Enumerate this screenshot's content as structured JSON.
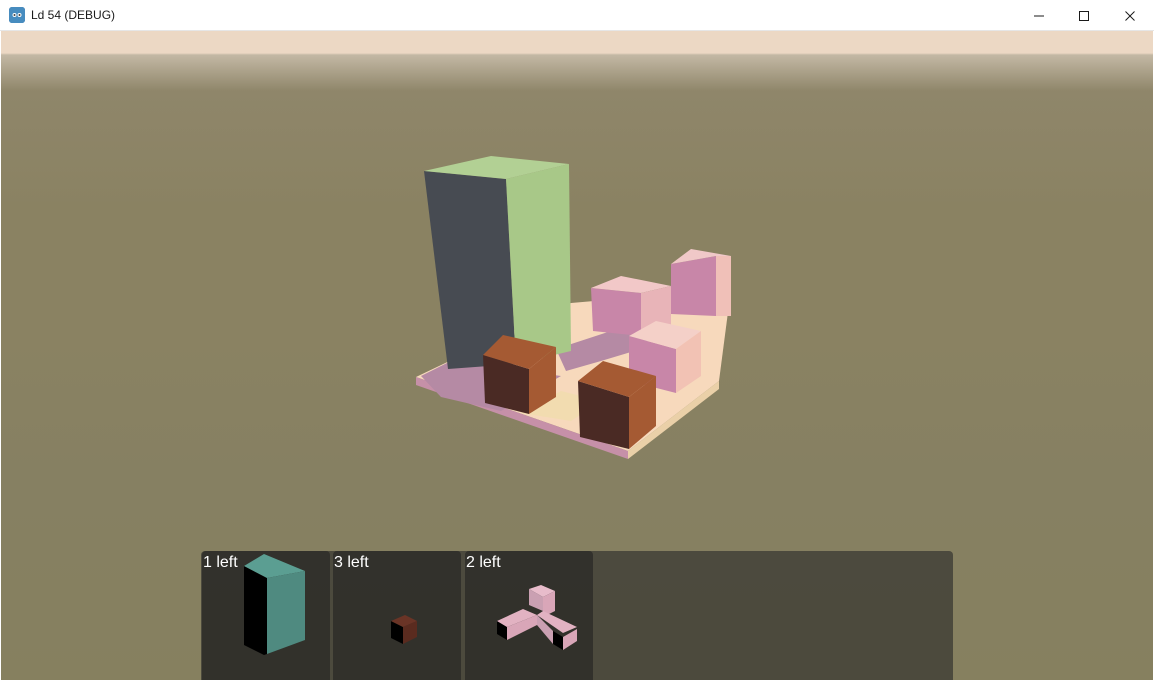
{
  "window": {
    "title": "Ld 54 (DEBUG)",
    "controls": {
      "minimize": "minimize-icon",
      "maximize": "maximize-icon",
      "close": "close-icon"
    }
  },
  "inventory": {
    "slots": [
      {
        "count_label": "1 left",
        "piece": "tall-block-icon",
        "color": "#4f8a80"
      },
      {
        "count_label": "3 left",
        "piece": "small-cube-icon",
        "color": "#5a2b1f"
      },
      {
        "count_label": "2 left",
        "piece": "l-piece-icon",
        "color": "#d9a6b8"
      }
    ]
  },
  "colors": {
    "sky": "#ecd8c4",
    "ground": "#8a8262",
    "green_block": "#a8c888",
    "brown_block": "#a55a33",
    "pink_block": "#d8a0b4",
    "base_plate": "#f7d9bc"
  }
}
